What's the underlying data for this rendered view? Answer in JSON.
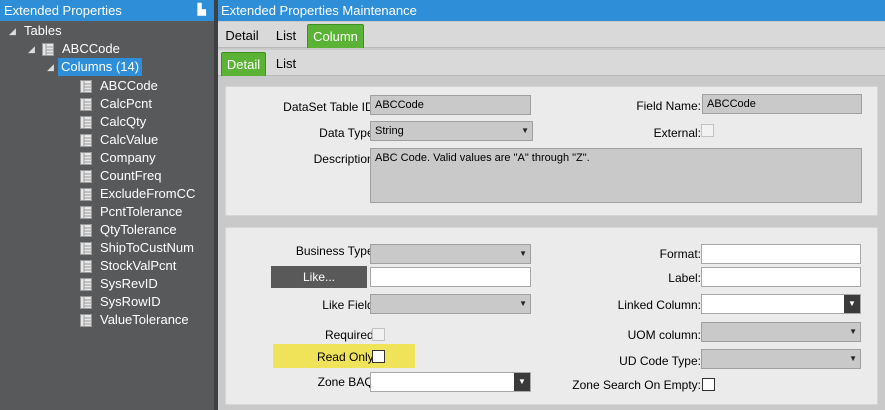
{
  "left_panel": {
    "title": "Extended Properties",
    "pin_glyph": "▙",
    "tree": {
      "root": "Tables",
      "table": "ABCCode",
      "columns_node": "Columns (14)",
      "columns": [
        "ABCCode",
        "CalcPcnt",
        "CalcQty",
        "CalcValue",
        "Company",
        "CountFreq",
        "ExcludeFromCC",
        "PcntTolerance",
        "QtyTolerance",
        "ShipToCustNum",
        "StockValPcnt",
        "SysRevID",
        "SysRowID",
        "ValueTolerance"
      ]
    }
  },
  "right_panel": {
    "title": "Extended Properties Maintenance",
    "tabs_top": [
      "Detail",
      "List",
      "Column"
    ],
    "tabs_sub": [
      "Detail",
      "List"
    ],
    "dataset": {
      "dataset_table_id_label": "DataSet Table ID:",
      "dataset_table_id_value": "ABCCode",
      "field_name_label": "Field Name:",
      "field_name_value": "ABCCode",
      "data_type_label": "Data Type:",
      "data_type_value": "String",
      "external_label": "External:",
      "description_label": "Description:",
      "description_value": "ABC Code.  Valid values are \"A\" through \"Z\"."
    },
    "props": {
      "business_type_label": "Business Type:",
      "business_type_value": "",
      "like_button": "Like...",
      "like_value": "",
      "like_field_label": "Like Field:",
      "like_field_value": "",
      "required_label": "Required:",
      "read_only_label": "Read Only:",
      "zone_baq_label": "Zone BAQ:",
      "zone_baq_value": "",
      "format_label": "Format:",
      "format_value": "",
      "label_label": "Label:",
      "label_value": "",
      "linked_column_label": "Linked Column:",
      "linked_column_value": "",
      "uom_column_label": "UOM column:",
      "uom_column_value": "",
      "ud_code_type_label": "UD Code Type:",
      "ud_code_type_value": "",
      "zone_search_label": "Zone Search On Empty:"
    }
  },
  "colors": {
    "title_blue": "#2e8fd8",
    "tab_green": "#5bb336",
    "tree_bg": "#58595b",
    "highlight_yellow": "#efe35a"
  }
}
